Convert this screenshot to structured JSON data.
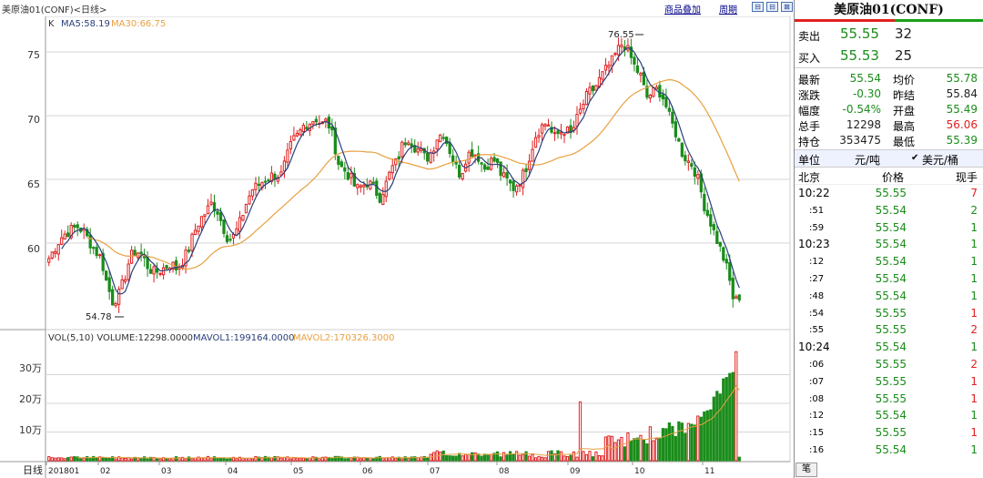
{
  "window": {
    "title": "美原油01(CONF)<日线>",
    "links": [
      "商品叠加",
      "周期"
    ],
    "window_buttons": [
      "restore",
      "minimize",
      "close"
    ]
  },
  "price_chart": {
    "legend": {
      "k": "K",
      "ma5": "MA5:58.19",
      "ma30": "MA30:66.75"
    },
    "high_marker": "76.55",
    "low_marker": "54.78",
    "y_ticks": [
      "75",
      "70",
      "65",
      "60"
    ]
  },
  "volume_chart": {
    "legend": {
      "vol": "VOL(5,10) VOLUME:12298.0000",
      "mavol1": "MAVOL1:199164.0000",
      "mavol2": "MAVOL2:170326.3000"
    },
    "y_ticks": [
      "30万",
      "20万",
      "10万"
    ]
  },
  "x_axis": {
    "period_label": "日线",
    "ticks": [
      "201801",
      "02",
      "03",
      "04",
      "05",
      "06",
      "07",
      "08",
      "09",
      "10",
      "11"
    ]
  },
  "chart_data": {
    "type": "candlestick",
    "instrument": "美原油01(CONF)",
    "period": "日线",
    "price_ylim": [
      53.5,
      77.5
    ],
    "volume_ylim": [
      0,
      400000
    ],
    "months": [
      "201801",
      "02",
      "03",
      "04",
      "05",
      "06",
      "07",
      "08",
      "09",
      "10",
      "11"
    ],
    "close_path": [
      58.8,
      59.6,
      60.4,
      60.8,
      61.1,
      61.3,
      60.9,
      60.1,
      59.4,
      58.8,
      56.8,
      55.4,
      55.9,
      57.2,
      58.9,
      59.4,
      59.1,
      58.2,
      57.7,
      57.8,
      58.1,
      58.4,
      58.0,
      58.6,
      59.4,
      60.8,
      61.8,
      62.4,
      63.1,
      62.6,
      61.3,
      60.2,
      60.6,
      61.7,
      63.1,
      64.2,
      64.5,
      64.9,
      65.2,
      65.4,
      65.3,
      66.7,
      68.0,
      68.5,
      69.3,
      69.5,
      69.8,
      69.3,
      69.6,
      68.2,
      66.1,
      65.7,
      65.1,
      64.2,
      64.5,
      64.8,
      64.3,
      63.6,
      64.5,
      65.8,
      66.4,
      67.8,
      68.3,
      67.6,
      67.2,
      66.6,
      67.2,
      68.4,
      68.6,
      67.4,
      66.1,
      65.3,
      66.9,
      67.2,
      66.8,
      65.8,
      66.4,
      66.5,
      65.3,
      64.9,
      64.3,
      64.8,
      65.6,
      67.1,
      68.6,
      69.2,
      69.5,
      68.2,
      68.7,
      68.9,
      68.5,
      69.7,
      70.8,
      71.8,
      72.1,
      72.9,
      73.6,
      74.2,
      75.1,
      75.8,
      74.9,
      73.8,
      73.1,
      71.4,
      71.8,
      72.1,
      71.3,
      69.8,
      68.7,
      67.2,
      66.5,
      66.1,
      64.8,
      62.9,
      61.7,
      60.4,
      59.2,
      57.8,
      55.5,
      55.5
    ],
    "ma5_last": 58.19,
    "ma30_last": 66.75,
    "high": 76.55,
    "low": 54.78,
    "last_volume": 12298,
    "mavol1_last": 199164,
    "mavol2_last": 170326.3
  },
  "quote_panel": {
    "symbol": "美原油01(CONF)",
    "ask": {
      "label": "卖出",
      "price": "55.55",
      "size": "32"
    },
    "bid": {
      "label": "买入",
      "price": "55.53",
      "size": "25"
    },
    "stats": [
      {
        "l1": "最新",
        "v1": "55.54",
        "c1": "green",
        "l2": "均价",
        "v2": "55.78",
        "c2": "green"
      },
      {
        "l1": "涨跌",
        "v1": "-0.30",
        "c1": "green",
        "l2": "昨结",
        "v2": "55.84",
        "c2": "dark"
      },
      {
        "l1": "幅度",
        "v1": "-0.54%",
        "c1": "green",
        "l2": "开盘",
        "v2": "55.49",
        "c2": "green"
      },
      {
        "l1": "总手",
        "v1": "12298",
        "c1": "dark",
        "l2": "最高",
        "v2": "56.06",
        "c2": "red"
      },
      {
        "l1": "持仓",
        "v1": "353475",
        "c1": "dark",
        "l2": "最低",
        "v2": "55.39",
        "c2": "green"
      }
    ],
    "unit": {
      "label": "单位",
      "value": "元/吨",
      "check": "✔",
      "alt": "美元/桶"
    },
    "ticks_header": {
      "time": "北京",
      "price": "价格",
      "qty": "现手"
    },
    "ticks": [
      {
        "time": "10:22",
        "price": "55.55",
        "qty": "7",
        "pc": "green",
        "qc": "red",
        "big": true
      },
      {
        "time": ":51",
        "price": "55.54",
        "qty": "2",
        "pc": "green",
        "qc": "green",
        "big": false
      },
      {
        "time": ":59",
        "price": "55.54",
        "qty": "1",
        "pc": "green",
        "qc": "green",
        "big": false
      },
      {
        "time": "10:23",
        "price": "55.54",
        "qty": "1",
        "pc": "green",
        "qc": "green",
        "big": true
      },
      {
        "time": ":12",
        "price": "55.54",
        "qty": "1",
        "pc": "green",
        "qc": "green",
        "big": false
      },
      {
        "time": ":27",
        "price": "55.54",
        "qty": "1",
        "pc": "green",
        "qc": "green",
        "big": false
      },
      {
        "time": ":48",
        "price": "55.54",
        "qty": "1",
        "pc": "green",
        "qc": "green",
        "big": false
      },
      {
        "time": ":54",
        "price": "55.55",
        "qty": "1",
        "pc": "green",
        "qc": "red",
        "big": false
      },
      {
        "time": ":55",
        "price": "55.55",
        "qty": "2",
        "pc": "green",
        "qc": "red",
        "big": false
      },
      {
        "time": "10:24",
        "price": "55.54",
        "qty": "1",
        "pc": "green",
        "qc": "green",
        "big": true
      },
      {
        "time": ":06",
        "price": "55.55",
        "qty": "2",
        "pc": "green",
        "qc": "red",
        "big": false
      },
      {
        "time": ":07",
        "price": "55.55",
        "qty": "1",
        "pc": "green",
        "qc": "red",
        "big": false
      },
      {
        "time": ":08",
        "price": "55.55",
        "qty": "1",
        "pc": "green",
        "qc": "red",
        "big": false
      },
      {
        "time": ":12",
        "price": "55.54",
        "qty": "1",
        "pc": "green",
        "qc": "green",
        "big": false
      },
      {
        "time": ":15",
        "price": "55.55",
        "qty": "1",
        "pc": "green",
        "qc": "red",
        "big": false
      },
      {
        "time": ":16",
        "price": "55.54",
        "qty": "1",
        "pc": "green",
        "qc": "green",
        "big": false
      }
    ],
    "footer_tab": "笔"
  },
  "colors": {
    "up": "#e02020",
    "down": "#1a8c1a",
    "ma5": "#2a3f7a",
    "ma30": "#e8a040",
    "grid": "#d6d6d6",
    "accent_link": "#00008b"
  }
}
